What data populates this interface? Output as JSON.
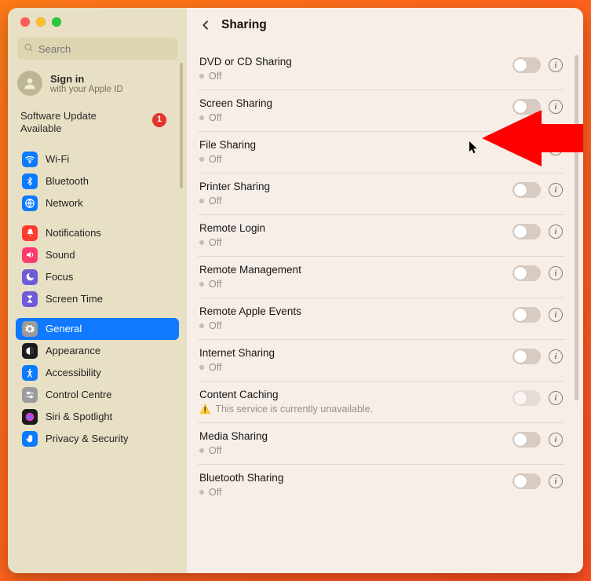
{
  "window": {
    "traffic_lights": [
      "close",
      "minimize",
      "zoom"
    ]
  },
  "search": {
    "placeholder": "Search"
  },
  "signin": {
    "title": "Sign in",
    "subtitle": "with your Apple ID"
  },
  "software_update": {
    "line1": "Software Update",
    "line2": "Available",
    "badge": "1"
  },
  "nav": {
    "groups": [
      [
        {
          "id": "wifi",
          "label": "Wi-Fi",
          "icon_bg": "#0a7aff",
          "glyph": "wifi"
        },
        {
          "id": "bluetooth",
          "label": "Bluetooth",
          "icon_bg": "#0a7aff",
          "glyph": "bluetooth"
        },
        {
          "id": "network",
          "label": "Network",
          "icon_bg": "#0a7aff",
          "glyph": "globe"
        }
      ],
      [
        {
          "id": "notifications",
          "label": "Notifications",
          "icon_bg": "#ff3b30",
          "glyph": "bell"
        },
        {
          "id": "sound",
          "label": "Sound",
          "icon_bg": "#ff3b6e",
          "glyph": "speaker"
        },
        {
          "id": "focus",
          "label": "Focus",
          "icon_bg": "#6e5bd6",
          "glyph": "moon"
        },
        {
          "id": "screentime",
          "label": "Screen Time",
          "icon_bg": "#6e5bd6",
          "glyph": "hourglass"
        }
      ],
      [
        {
          "id": "general",
          "label": "General",
          "icon_bg": "#9b9b9b",
          "glyph": "gear",
          "selected": true
        },
        {
          "id": "appearance",
          "label": "Appearance",
          "icon_bg": "#1c1c1e",
          "glyph": "appearance"
        },
        {
          "id": "accessibility",
          "label": "Accessibility",
          "icon_bg": "#0a7aff",
          "glyph": "accessibility"
        },
        {
          "id": "control-centre",
          "label": "Control Centre",
          "icon_bg": "#9b9b9b",
          "glyph": "switches"
        },
        {
          "id": "siri",
          "label": "Siri & Spotlight",
          "icon_bg": "#1c1c1e",
          "glyph": "siri"
        },
        {
          "id": "privacy",
          "label": "Privacy & Security",
          "icon_bg": "#0a7aff",
          "glyph": "hand"
        }
      ]
    ]
  },
  "header": {
    "title": "Sharing"
  },
  "rows": [
    {
      "id": "dvd",
      "title": "DVD or CD Sharing",
      "status": "Off",
      "toggle": false
    },
    {
      "id": "screen-sharing",
      "title": "Screen Sharing",
      "status": "Off",
      "toggle": false,
      "highlight_arrow": true
    },
    {
      "id": "file-sharing",
      "title": "File Sharing",
      "status": "Off",
      "toggle": false
    },
    {
      "id": "printer-sharing",
      "title": "Printer Sharing",
      "status": "Off",
      "toggle": false
    },
    {
      "id": "remote-login",
      "title": "Remote Login",
      "status": "Off",
      "toggle": false
    },
    {
      "id": "remote-management",
      "title": "Remote Management",
      "status": "Off",
      "toggle": false
    },
    {
      "id": "remote-apple-events",
      "title": "Remote Apple Events",
      "status": "Off",
      "toggle": false
    },
    {
      "id": "internet-sharing",
      "title": "Internet Sharing",
      "status": "Off",
      "toggle": false
    },
    {
      "id": "content-caching",
      "title": "Content Caching",
      "status_warning": "This service is currently unavailable.",
      "toggle": false,
      "disabled": true
    },
    {
      "id": "media-sharing",
      "title": "Media Sharing",
      "status": "Off",
      "toggle": false
    },
    {
      "id": "bluetooth-sharing",
      "title": "Bluetooth Sharing",
      "status": "Off",
      "toggle": false
    }
  ],
  "icons": {
    "wifi": "wifi-icon",
    "bluetooth": "bluetooth-icon",
    "globe": "globe-icon",
    "bell": "bell-icon",
    "speaker": "speaker-icon",
    "moon": "moon-icon",
    "hourglass": "hourglass-icon",
    "gear": "gear-icon",
    "appearance": "appearance-icon",
    "accessibility": "accessibility-icon",
    "switches": "switches-icon",
    "siri": "siri-icon",
    "hand": "hand-icon"
  }
}
